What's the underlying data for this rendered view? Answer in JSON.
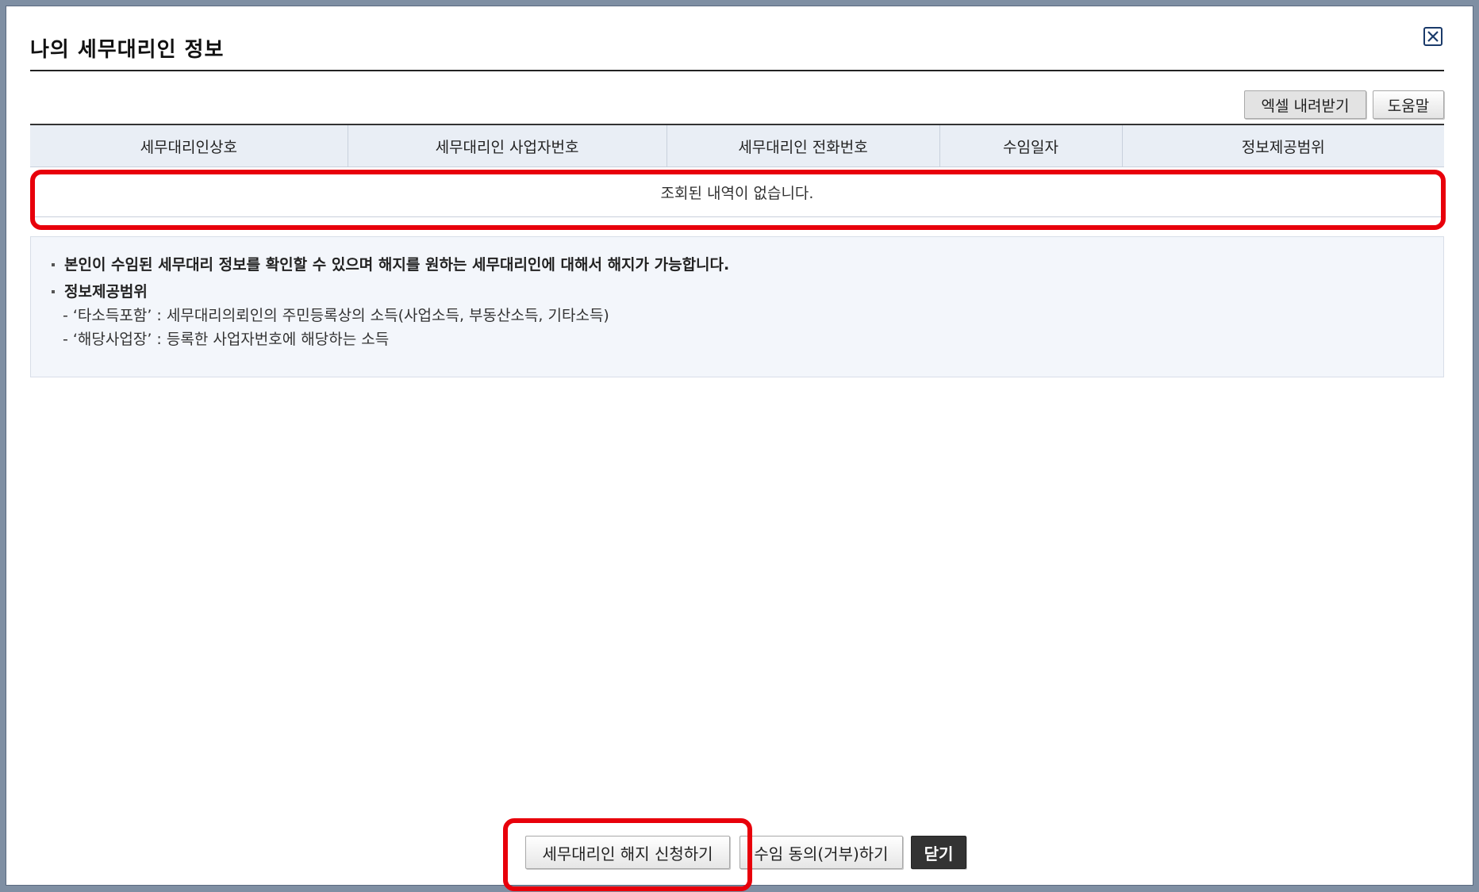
{
  "window": {
    "title": "나의 세무대리인 정보"
  },
  "toolbar": {
    "excel_label": "엑셀 내려받기",
    "help_label": "도움말"
  },
  "table": {
    "columns": [
      "세무대리인상호",
      "세무대리인 사업자번호",
      "세무대리인 전화번호",
      "수임일자",
      "정보제공범위"
    ],
    "empty_message": "조회된 내역이 없습니다."
  },
  "info": {
    "bullet1": "본인이 수임된 세무대리 정보를 확인할 수 있으며 해지를 원하는 세무대리인에 대해서 해지가 가능합니다.",
    "bullet2": "정보제공범위",
    "sub1": "- ‘타소득포함’ : 세무대리의뢰인의 주민등록상의 소득(사업소득, 부동산소득, 기타소득)",
    "sub2": "- ‘해당사업장’ : 등록한 사업자번호에 해당하는 소득"
  },
  "footer": {
    "cancel_label": "세무대리인 해지 신청하기",
    "consent_label": "수임 동의(거부)하기",
    "close_label": "닫기"
  },
  "icons": {
    "close": "close-icon"
  },
  "colors": {
    "highlight": "#e8000b",
    "header_bg": "#e9eef5",
    "info_bg": "#f3f6fb"
  }
}
